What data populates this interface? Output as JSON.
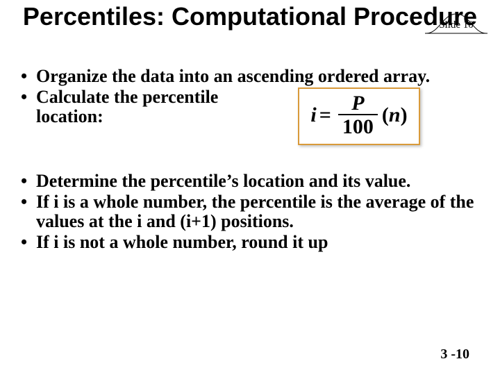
{
  "title": "Percentiles: Computational Procedure",
  "slide_label": "Slide 10",
  "bullets_top": [
    "Organize the data into an ascending ordered array.",
    "Calculate the percentile location:"
  ],
  "formula": {
    "lhs": "i",
    "eq": "=",
    "num": "P",
    "den": "100",
    "rhs_open": "(",
    "rhs_var": "n",
    "rhs_close": ")"
  },
  "bullets_bottom": [
    "Determine the percentile’s location and its value.",
    "If i  is a whole number, the percentile is the average of the values at the i and (i+1) positions.",
    "If i  is not a whole number, round it up"
  ],
  "page_number": "3 -10"
}
